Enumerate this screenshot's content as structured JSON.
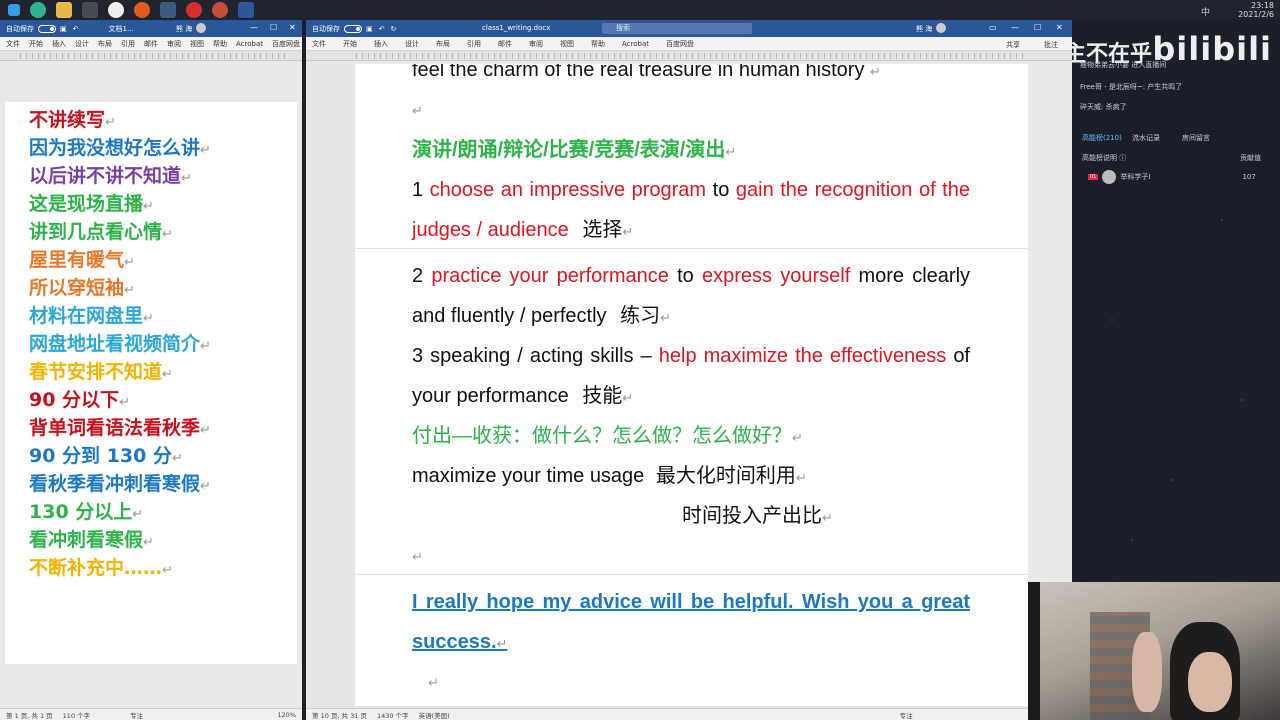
{
  "taskbar": {
    "time": "23:18",
    "date": "2021/2/6",
    "ime": "中",
    "app_icons": [
      "windows-icon",
      "edge-icon",
      "explorer-icon",
      "wechat-icon",
      "obs-icon",
      "firefox-icon",
      "steam-icon",
      "netease-icon",
      "chrome-icon",
      "word-icon"
    ]
  },
  "left_window": {
    "autosave": "自动保存",
    "doc_name": "文档1...",
    "user": "熊 海",
    "menu": [
      "文件",
      "开始",
      "插入",
      "设计",
      "布局",
      "引用",
      "邮件",
      "审阅",
      "视图",
      "帮助",
      "Acrobat",
      "百度网盘"
    ],
    "status": {
      "page": "第 1 页, 共 1 页",
      "words": "110 个字",
      "focus": "专注",
      "zoom": "120%"
    },
    "lines": [
      {
        "text": "不讲续写",
        "color": "#c8101c"
      },
      {
        "text": "因为我没想好怎么讲",
        "color": "#1d78c4"
      },
      {
        "text": "以后讲不讲不知道",
        "color": "#7a3fa6"
      },
      {
        "text": "这是现场直播",
        "color": "#2db34a"
      },
      {
        "text": "讲到几点看心情",
        "color": "#2db34a"
      },
      {
        "text": "屋里有暖气",
        "color": "#e8792a"
      },
      {
        "text": "所以穿短袖",
        "color": "#e8792a"
      },
      {
        "text": "材料在网盘里",
        "color": "#2aa6d8"
      },
      {
        "text": "网盘地址看视频简介",
        "color": "#2aa6d8"
      },
      {
        "text": "春节安排不知道",
        "color": "#f0b400"
      },
      {
        "text": "90 分以下",
        "color": "#c8101c"
      },
      {
        "text": "背单词看语法看秋季",
        "color": "#c8101c"
      },
      {
        "text": "90 分到 130 分",
        "color": "#1d78c4"
      },
      {
        "text": "看秋季看冲刺看寒假",
        "color": "#1d78c4"
      },
      {
        "text": "130 分以上",
        "color": "#2db34a"
      },
      {
        "text": "看冲刺看寒假",
        "color": "#2db34a"
      },
      {
        "text": "不断补充中……",
        "color": "#f0b400"
      }
    ]
  },
  "right_window": {
    "autosave": "自动保存",
    "doc_name": "class1_writing.docx",
    "search_placeholder": "搜索",
    "user": "熊 海",
    "menu": [
      "文件",
      "开始",
      "插入",
      "设计",
      "布局",
      "引用",
      "邮件",
      "审阅",
      "视图",
      "帮助",
      "Acrobat",
      "百度网盘"
    ],
    "share": "共享",
    "comment": "批注",
    "status": {
      "page": "第 10 页, 共 31 页",
      "words": "1430 个字",
      "lang": "英语(美国)",
      "focus": "专注"
    },
    "doc": {
      "top_line": "feel the charm of the real treasure in human history",
      "heading": "演讲/朗诵/辩论/比赛/竞赛/表演/演出",
      "item1_num": "1",
      "item1_red1": "choose an impressive program",
      "item1_to": "to",
      "item1_red2": "gain the recognition of the judges / audience",
      "item1_cn": "选择",
      "item2_num": "2",
      "item2_red1": "practice your performance",
      "item2_to": "to",
      "item2_red2": "express yourself",
      "item2_rest": "more clearly and fluently / perfectly",
      "item2_cn": "练习",
      "item3_lead": "3 speaking / acting skills –",
      "item3_red": "help maximize the effectiveness",
      "item3_rest": "of your performance",
      "item3_cn": "技能",
      "green_q": "付出—收获：做什么？怎么做？怎么做好？",
      "max_line": "maximize your time usage",
      "max_cn": "最大化时间利用",
      "ratio_cn": "时间投入产出比",
      "closing": "I really hope my advice will be helpful. Wish you a great success."
    }
  },
  "stream": {
    "brand": "bilibili",
    "overlay_text": "主不在乎",
    "chat": [
      "瘦物弟弟云小宴  进入直播间",
      "Free哥 - 是北辰呀~: 产生共鸣了",
      "碎天威: 杀疯了"
    ],
    "tabs": [
      "高能榜(210)",
      "流水记录",
      "房间留言"
    ],
    "rank_title": "高能榜说明",
    "rank_right": "贡献值",
    "rank_user": "举科学子I",
    "rank_value": "107"
  }
}
